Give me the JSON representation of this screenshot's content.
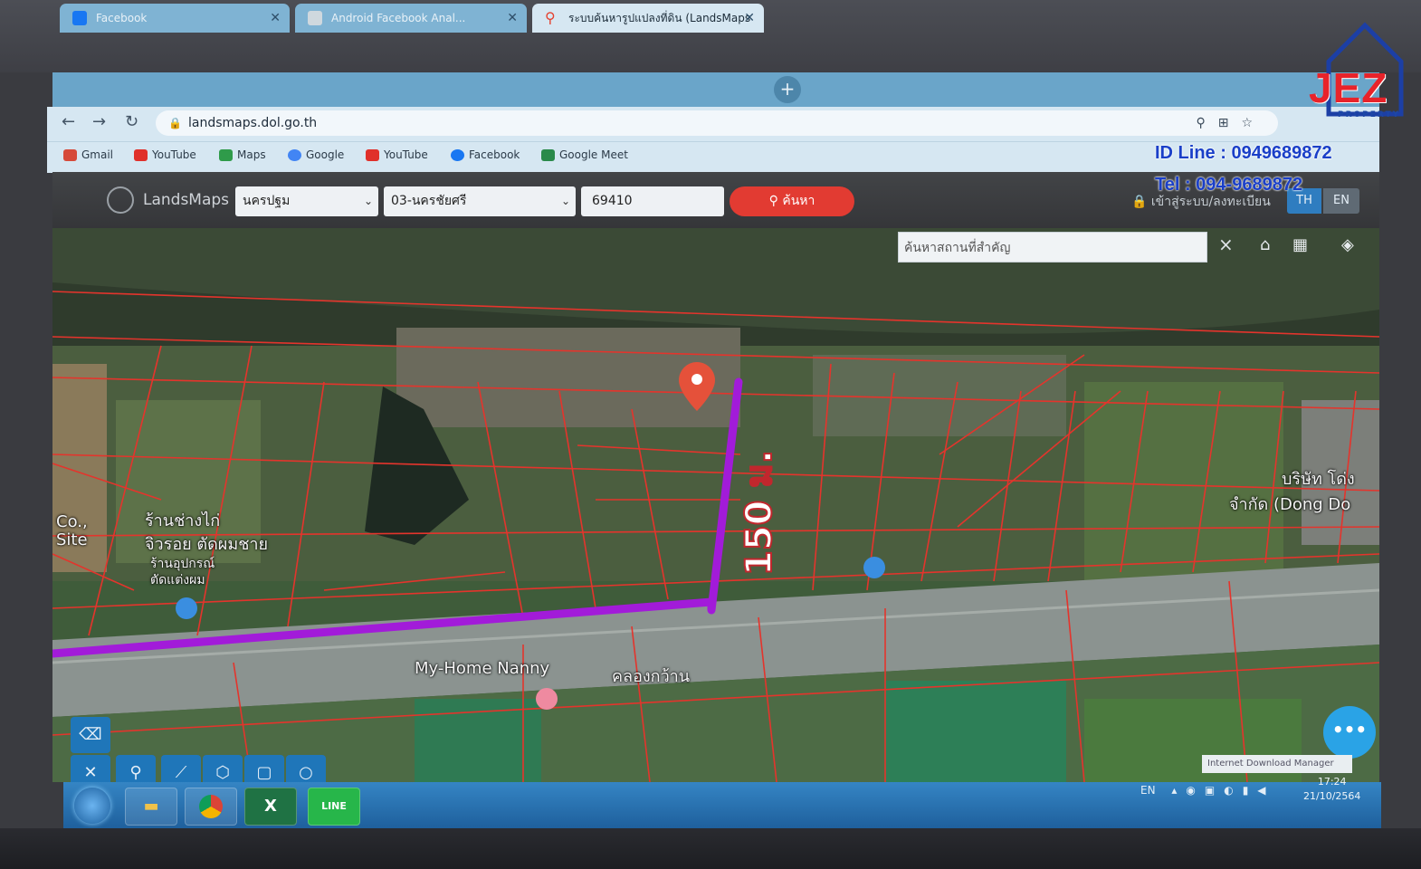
{
  "browser": {
    "tabs": [
      {
        "label": "Facebook",
        "favicon": "facebook-icon"
      },
      {
        "label": "Android Facebook Anal...",
        "favicon": "site-icon"
      },
      {
        "label": "ระบบค้นหารูปแปลงที่ดิน (LandsMaps",
        "favicon": "map-pin-icon"
      }
    ],
    "new_tab": "+",
    "url": "landsmaps.dol.go.th",
    "bookmarks": [
      {
        "label": "Gmail",
        "color": "#d64a3a"
      },
      {
        "label": "YouTube",
        "color": "#e0302a"
      },
      {
        "label": "Maps",
        "color": "#2f9b4a"
      },
      {
        "label": "Google",
        "color": "#4285f4"
      },
      {
        "label": "YouTube",
        "color": "#e0302a"
      },
      {
        "label": "Facebook",
        "color": "#1877f2"
      },
      {
        "label": "Google Meet",
        "color": "#2a8a4a"
      }
    ]
  },
  "app": {
    "title": "LandsMaps",
    "province": "นครปฐม",
    "district": "03-นครชัยศรี",
    "parcel_no": "69410",
    "search_label": "ค้นหา",
    "login_label": "เข้าสู่ระบบ/ลงทะเบียน",
    "lang": [
      "TH",
      "EN"
    ],
    "place_search_placeholder": "ค้นหาสถานที่สำคัญ",
    "close": "×"
  },
  "map": {
    "measurement": "150 ม.",
    "labels": {
      "road_label": "My-Home Nanny",
      "canal_label": "คลองกว้าน",
      "shop_label_1": "ร้านช่างไก่",
      "shop_label_2": "จิวรอย ตัดผมชาย",
      "shop_label_3": "ร้านอุปกรณ์",
      "shop_label_4": "ตัดแต่งผม",
      "company_label": "บริษัท โด่ง",
      "company_label_2": "จำกัด (Dong Do",
      "cut_label": "Co.,",
      "cut_label_2": "Site"
    },
    "fab": "•••",
    "colors": {
      "parcel_lines": "#e4342c",
      "route": "#a21bd9"
    }
  },
  "taskbar": {
    "apps": [
      "folder",
      "chrome",
      "excel",
      "line"
    ],
    "excel_glyph": "X",
    "line_glyph": "LINE",
    "idm": "Internet Download Manager",
    "lang": "EN",
    "time": "17:24",
    "date": "21/10/2564"
  },
  "watermark": {
    "brand": "JEZ",
    "sub": "PROPERTY",
    "id_line": "ID Line : 0949689872",
    "tel": "Tel : 094-9689872"
  }
}
